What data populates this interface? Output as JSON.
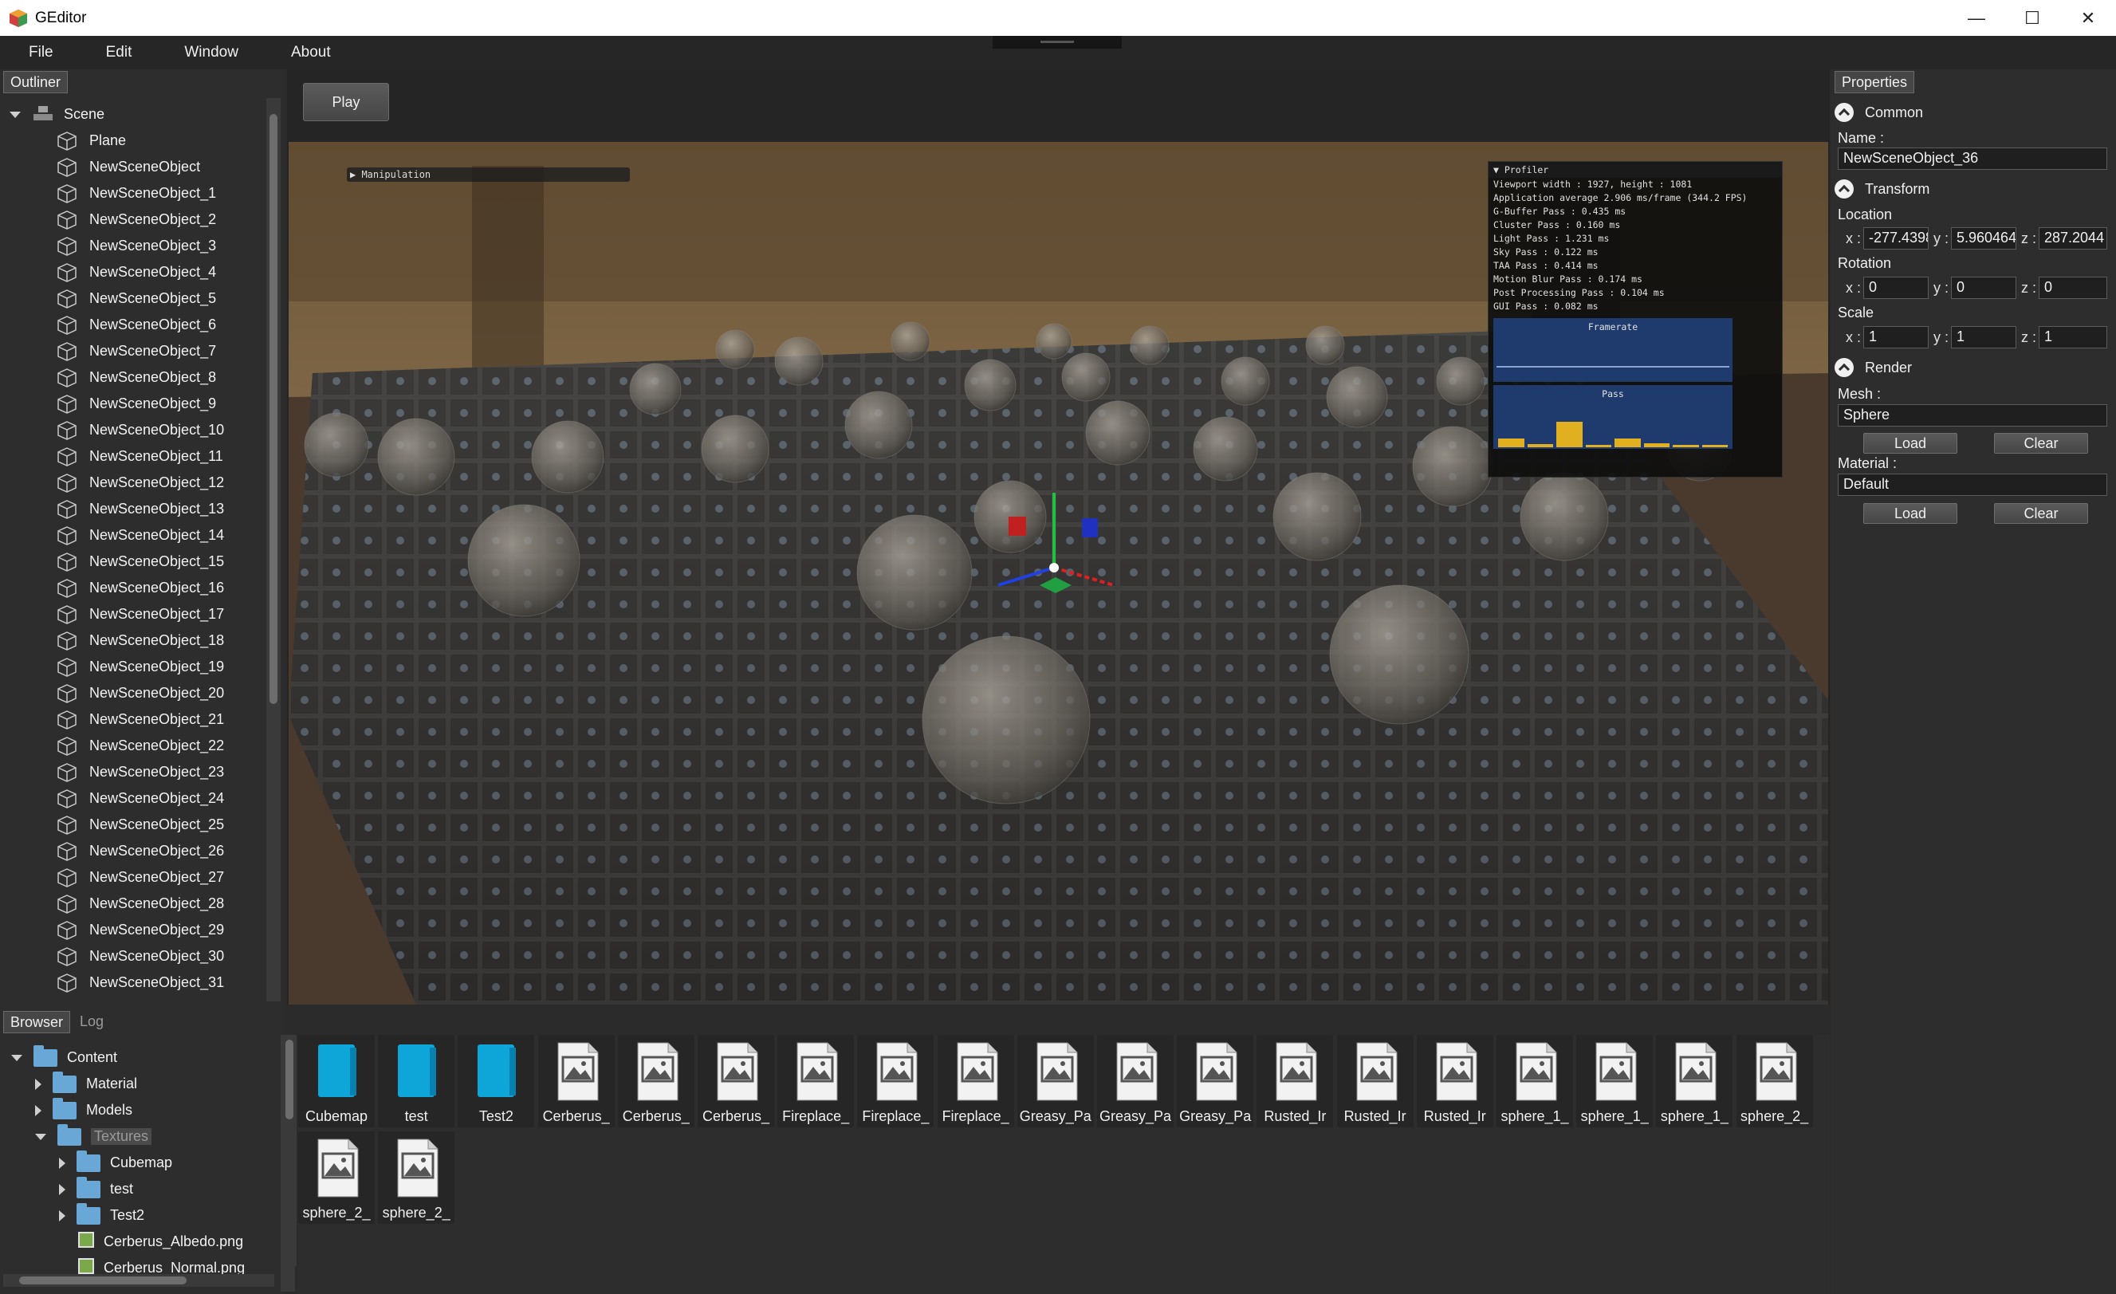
{
  "window": {
    "title": "GEditor",
    "minimize": "—",
    "maximize": "☐",
    "close": "✕"
  },
  "menu": [
    "File",
    "Edit",
    "Window",
    "About"
  ],
  "outliner": {
    "tab": "Outliner",
    "root": "Scene",
    "items": [
      "Plane",
      "NewSceneObject",
      "NewSceneObject_1",
      "NewSceneObject_2",
      "NewSceneObject_3",
      "NewSceneObject_4",
      "NewSceneObject_5",
      "NewSceneObject_6",
      "NewSceneObject_7",
      "NewSceneObject_8",
      "NewSceneObject_9",
      "NewSceneObject_10",
      "NewSceneObject_11",
      "NewSceneObject_12",
      "NewSceneObject_13",
      "NewSceneObject_14",
      "NewSceneObject_15",
      "NewSceneObject_16",
      "NewSceneObject_17",
      "NewSceneObject_18",
      "NewSceneObject_19",
      "NewSceneObject_20",
      "NewSceneObject_21",
      "NewSceneObject_22",
      "NewSceneObject_23",
      "NewSceneObject_24",
      "NewSceneObject_25",
      "NewSceneObject_26",
      "NewSceneObject_27",
      "NewSceneObject_28",
      "NewSceneObject_29",
      "NewSceneObject_30",
      "NewSceneObject_31"
    ]
  },
  "viewport": {
    "play": "Play",
    "manipulation": "▶ Manipulation",
    "profiler": {
      "title": "▼ Profiler",
      "lines": [
        "Viewport width : 1927, height : 1081",
        "Application average 2.906 ms/frame (344.2 FPS)",
        "G-Buffer Pass : 0.435 ms",
        "Cluster Pass : 0.160 ms",
        "Light Pass : 1.231 ms",
        "Sky Pass : 0.122 ms",
        "TAA Pass : 0.414 ms",
        "Motion Blur Pass : 0.174 ms",
        "Post Processing Pass : 0.104 ms",
        "GUI Pass : 0.082 ms"
      ],
      "framerate_label": "Framerate",
      "pass_label": "Pass",
      "pass_values": [
        0.435,
        0.16,
        1.231,
        0.122,
        0.414,
        0.174,
        0.104,
        0.082
      ]
    }
  },
  "properties": {
    "tab": "Properties",
    "common": "Common",
    "name_label": "Name :",
    "name_value": "NewSceneObject_36",
    "transform": "Transform",
    "location_label": "Location",
    "location": {
      "x": "-277.4398",
      "y": "5.960464",
      "z": "287.2044"
    },
    "rotation_label": "Rotation",
    "rotation": {
      "x": "0",
      "y": "0",
      "z": "0"
    },
    "scale_label": "Scale",
    "scale": {
      "x": "1",
      "y": "1",
      "z": "1"
    },
    "render": "Render",
    "mesh_label": "Mesh :",
    "mesh_value": "Sphere",
    "material_label": "Material :",
    "material_value": "Default",
    "load": "Load",
    "clear": "Clear",
    "x": "x :",
    "y": "y :",
    "z": "z :"
  },
  "browser": {
    "tab_browser": "Browser",
    "tab_log": "Log",
    "tree": [
      {
        "label": "Content",
        "type": "folder"
      },
      {
        "label": "Material",
        "type": "folder"
      },
      {
        "label": "Models",
        "type": "folder"
      },
      {
        "label": "Textures",
        "type": "folder"
      },
      {
        "label": "Cubemap",
        "type": "folder"
      },
      {
        "label": "test",
        "type": "folder"
      },
      {
        "label": "Test2",
        "type": "folder"
      },
      {
        "label": "Cerberus_Albedo.png",
        "type": "image"
      },
      {
        "label": "Cerberus_Normal.png",
        "type": "image"
      }
    ],
    "files": [
      {
        "label": "Cubemap",
        "type": "folder"
      },
      {
        "label": "test",
        "type": "folder"
      },
      {
        "label": "Test2",
        "type": "folder"
      },
      {
        "label": "Cerberus_",
        "type": "image"
      },
      {
        "label": "Cerberus_",
        "type": "image"
      },
      {
        "label": "Cerberus_",
        "type": "image"
      },
      {
        "label": "Fireplace_",
        "type": "image"
      },
      {
        "label": "Fireplace_",
        "type": "image"
      },
      {
        "label": "Fireplace_",
        "type": "image"
      },
      {
        "label": "Greasy_Pa",
        "type": "image"
      },
      {
        "label": "Greasy_Pa",
        "type": "image"
      },
      {
        "label": "Greasy_Pa",
        "type": "image"
      },
      {
        "label": "Rusted_Ir",
        "type": "image"
      },
      {
        "label": "Rusted_Ir",
        "type": "image"
      },
      {
        "label": "Rusted_Ir",
        "type": "image"
      },
      {
        "label": "sphere_1_",
        "type": "image"
      },
      {
        "label": "sphere_1_",
        "type": "image"
      },
      {
        "label": "sphere_1_",
        "type": "image"
      },
      {
        "label": "sphere_2_",
        "type": "image"
      },
      {
        "label": "sphere_2_",
        "type": "image"
      },
      {
        "label": "sphere_2_",
        "type": "image"
      }
    ]
  },
  "colors": {
    "accent_folder": "#0ea5d8",
    "panel": "#2d2d2d",
    "graph": "#1f3a6c",
    "bar": "#e0b020"
  }
}
